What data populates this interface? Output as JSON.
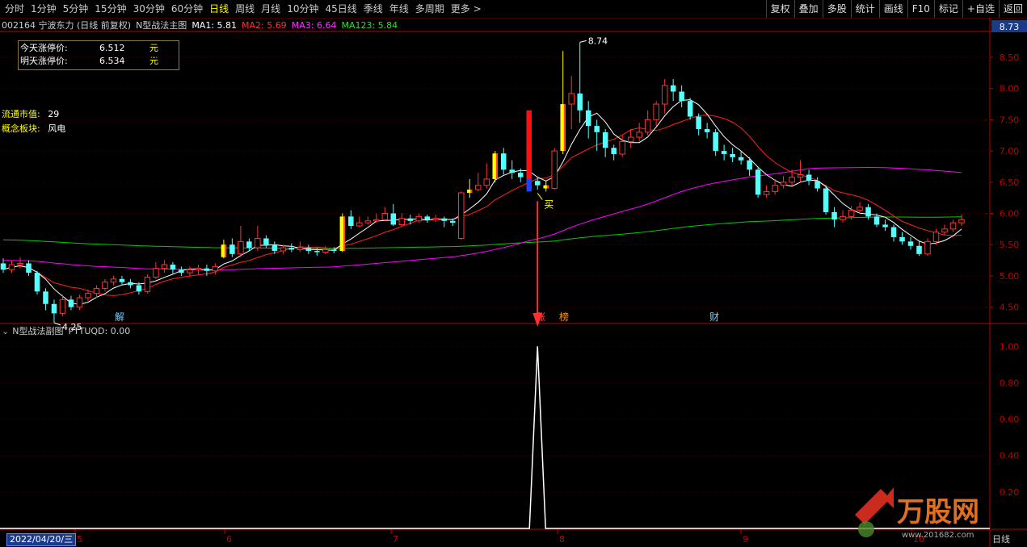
{
  "toolbar": {
    "periods": [
      "分时",
      "1分钟",
      "5分钟",
      "15分钟",
      "30分钟",
      "60分钟",
      "日线",
      "周线",
      "月线",
      "10分钟",
      "45日线",
      "季线",
      "年线",
      "多周期",
      "更多 >"
    ],
    "active": "日线",
    "buttons": [
      "复权",
      "叠加",
      "多股",
      "统计",
      "画线",
      "F10",
      "标记",
      "+自选",
      "返回"
    ]
  },
  "header": {
    "stock": "002164 宁波东力 (日线 前复权)",
    "indicator": "N型战法主图",
    "ma1": "MA1: 5.81",
    "ma2": "MA2: 5.69",
    "ma3": "MA3: 6.64",
    "ma123": "MA123: 5.84",
    "price_tag": "8.73"
  },
  "limit_box": {
    "today_label": "今天涨停价:",
    "today_value": "6.512",
    "tomorrow_label": "明天涨停价:",
    "tomorrow_value": "6.534",
    "unit": "元"
  },
  "side_info": {
    "float_cap_label": "流通市值:",
    "float_cap_value": "29",
    "concept_label": "概念板块:",
    "concept_value": "风电"
  },
  "subchart": {
    "title": "N型战法副图",
    "value": "PTTUQD: 0.00"
  },
  "date_label": "2022/04/20/三",
  "period_label": "日线",
  "logo": {
    "text": "万股网",
    "url": "www.201682.com"
  },
  "colors": {
    "up": "#ff3232",
    "down": "#54ffff",
    "ma1": "#ffffff",
    "ma2": "#ff2020",
    "ma3": "#ff00ff",
    "ma123": "#00cc00",
    "highlight": "#ffff00",
    "buy": "#ffff00",
    "axis": "#c00000"
  },
  "chart_data": [
    {
      "type": "candlestick",
      "title": "N型战法主图",
      "ylim": [
        4.25,
        8.9
      ],
      "yticks": [
        4.5,
        5.0,
        5.5,
        6.0,
        6.5,
        7.0,
        7.5,
        8.0,
        8.5
      ],
      "xticks": [
        "5",
        "6",
        "7",
        "8",
        "9",
        "10"
      ],
      "annotations": [
        {
          "text": "8.74",
          "type": "high"
        },
        {
          "text": "4.25",
          "type": "low"
        },
        {
          "text": "买",
          "type": "buy-signal"
        }
      ],
      "event_labels": [
        "解",
        "涨",
        "榜",
        "财"
      ],
      "candles": [
        [
          5.2,
          5.1,
          5.28,
          5.05
        ],
        [
          5.1,
          5.18,
          5.25,
          5.05
        ],
        [
          5.18,
          5.2,
          5.3,
          5.12
        ],
        [
          5.2,
          5.05,
          5.25,
          5.0
        ],
        [
          5.05,
          4.75,
          5.08,
          4.7
        ],
        [
          4.75,
          4.55,
          4.8,
          4.45
        ],
        [
          4.55,
          4.4,
          4.62,
          4.25
        ],
        [
          4.4,
          4.62,
          4.7,
          4.35
        ],
        [
          4.62,
          4.5,
          4.68,
          4.45
        ],
        [
          4.5,
          4.65,
          4.7,
          4.45
        ],
        [
          4.65,
          4.72,
          4.78,
          4.6
        ],
        [
          4.72,
          4.8,
          4.85,
          4.65
        ],
        [
          4.8,
          4.9,
          4.95,
          4.75
        ],
        [
          4.9,
          4.95,
          5.0,
          4.85
        ],
        [
          4.95,
          4.9,
          5.0,
          4.85
        ],
        [
          4.9,
          4.85,
          4.95,
          4.8
        ],
        [
          4.85,
          4.75,
          4.9,
          4.7
        ],
        [
          4.75,
          4.98,
          5.02,
          4.72
        ],
        [
          4.98,
          5.12,
          5.22,
          4.95
        ],
        [
          5.12,
          5.18,
          5.25,
          5.05
        ],
        [
          5.18,
          5.1,
          5.22,
          5.02
        ],
        [
          5.1,
          5.05,
          5.15,
          5.0
        ],
        [
          5.05,
          5.1,
          5.15,
          5.0
        ],
        [
          5.1,
          5.12,
          5.18,
          5.02
        ],
        [
          5.12,
          5.08,
          5.18,
          5.0
        ],
        [
          5.08,
          5.15,
          5.2,
          5.02
        ],
        [
          5.3,
          5.5,
          5.58,
          5.28
        ],
        [
          5.5,
          5.35,
          5.6,
          5.3
        ],
        [
          5.35,
          5.55,
          5.8,
          5.3
        ],
        [
          5.55,
          5.45,
          5.6,
          5.4
        ],
        [
          5.45,
          5.6,
          5.8,
          5.4
        ],
        [
          5.6,
          5.5,
          5.65,
          5.45
        ],
        [
          5.5,
          5.4,
          5.55,
          5.35
        ],
        [
          5.4,
          5.45,
          5.5,
          5.35
        ],
        [
          5.45,
          5.42,
          5.52,
          5.38
        ],
        [
          5.42,
          5.45,
          5.55,
          5.38
        ],
        [
          5.45,
          5.4,
          5.5,
          5.35
        ],
        [
          5.4,
          5.38,
          5.45,
          5.32
        ],
        [
          5.38,
          5.42,
          5.48,
          5.35
        ],
        [
          5.42,
          5.4,
          5.46,
          5.36
        ],
        [
          5.4,
          5.95,
          6.0,
          5.38
        ],
        [
          5.95,
          5.8,
          6.05,
          5.75
        ],
        [
          5.8,
          5.85,
          5.95,
          5.78
        ],
        [
          5.85,
          5.88,
          5.95,
          5.82
        ],
        [
          5.88,
          5.9,
          6.0,
          5.85
        ],
        [
          5.9,
          6.0,
          6.1,
          5.88
        ],
        [
          6.0,
          5.82,
          6.15,
          5.8
        ],
        [
          5.82,
          5.92,
          6.0,
          5.8
        ],
        [
          5.92,
          5.88,
          5.98,
          5.82
        ],
        [
          5.88,
          5.95,
          6.0,
          5.85
        ],
        [
          5.95,
          5.9,
          5.98,
          5.85
        ],
        [
          5.9,
          5.92,
          5.98,
          5.86
        ],
        [
          5.92,
          5.88,
          5.95,
          5.78
        ],
        [
          5.88,
          5.85,
          5.92,
          5.8
        ],
        [
          5.6,
          6.33,
          6.35,
          5.58
        ],
        [
          6.33,
          6.38,
          6.55,
          6.25
        ],
        [
          6.38,
          6.45,
          6.65,
          6.35
        ],
        [
          6.45,
          6.55,
          6.8,
          6.4
        ],
        [
          6.55,
          6.96,
          7.0,
          6.5
        ],
        [
          6.96,
          6.7,
          7.05,
          6.62
        ],
        [
          6.7,
          6.65,
          6.85,
          6.55
        ],
        [
          6.65,
          6.58,
          6.72,
          6.5
        ],
        [
          6.58,
          6.52,
          6.65,
          6.45
        ],
        [
          6.52,
          6.45,
          6.58,
          6.38
        ],
        [
          6.45,
          6.4,
          6.52,
          6.35
        ],
        [
          6.4,
          7.0,
          7.05,
          6.38
        ],
        [
          7.0,
          7.75,
          8.6,
          6.95
        ],
        [
          7.75,
          7.92,
          8.2,
          7.35
        ],
        [
          7.92,
          7.65,
          8.74,
          7.45
        ],
        [
          7.65,
          7.4,
          7.8,
          7.2
        ],
        [
          7.4,
          7.3,
          7.5,
          7.0
        ],
        [
          7.3,
          7.05,
          7.35,
          6.9
        ],
        [
          7.05,
          6.95,
          7.1,
          6.85
        ],
        [
          6.95,
          7.15,
          7.25,
          6.9
        ],
        [
          7.15,
          7.22,
          7.35,
          7.05
        ],
        [
          7.22,
          7.3,
          7.45,
          7.15
        ],
        [
          7.3,
          7.5,
          7.65,
          7.25
        ],
        [
          7.5,
          7.75,
          7.8,
          7.4
        ],
        [
          7.75,
          8.05,
          8.15,
          7.6
        ],
        [
          8.05,
          7.95,
          8.15,
          7.8
        ],
        [
          7.95,
          7.8,
          8.05,
          7.7
        ],
        [
          7.8,
          7.55,
          7.85,
          7.5
        ],
        [
          7.55,
          7.35,
          7.6,
          7.25
        ],
        [
          7.35,
          7.3,
          7.45,
          7.2
        ],
        [
          7.3,
          7.0,
          7.35,
          6.92
        ],
        [
          7.0,
          6.95,
          7.1,
          6.85
        ],
        [
          6.95,
          6.9,
          7.05,
          6.82
        ],
        [
          6.9,
          6.85,
          7.0,
          6.78
        ],
        [
          6.85,
          6.7,
          6.9,
          6.6
        ],
        [
          6.7,
          6.3,
          6.75,
          6.25
        ],
        [
          6.3,
          6.35,
          6.45,
          6.25
        ],
        [
          6.35,
          6.45,
          6.55,
          6.3
        ],
        [
          6.45,
          6.5,
          6.6,
          6.4
        ],
        [
          6.5,
          6.58,
          6.7,
          6.45
        ],
        [
          6.58,
          6.62,
          6.85,
          6.5
        ],
        [
          6.62,
          6.52,
          6.7,
          6.45
        ],
        [
          6.52,
          6.4,
          6.58,
          6.35
        ],
        [
          6.4,
          6.02,
          6.45,
          5.98
        ],
        [
          6.02,
          5.9,
          6.1,
          5.78
        ],
        [
          5.9,
          5.95,
          6.05,
          5.85
        ],
        [
          5.95,
          6.05,
          6.12,
          5.9
        ],
        [
          6.05,
          6.1,
          6.18,
          6.0
        ],
        [
          6.1,
          5.95,
          6.15,
          5.9
        ],
        [
          5.95,
          5.82,
          6.0,
          5.78
        ],
        [
          5.82,
          5.78,
          5.9,
          5.72
        ],
        [
          5.78,
          5.62,
          5.82,
          5.55
        ],
        [
          5.62,
          5.55,
          5.7,
          5.5
        ],
        [
          5.55,
          5.48,
          5.62,
          5.42
        ],
        [
          5.48,
          5.35,
          5.55,
          5.32
        ],
        [
          5.35,
          5.55,
          5.6,
          5.32
        ],
        [
          5.55,
          5.7,
          5.75,
          5.5
        ],
        [
          5.7,
          5.75,
          5.82,
          5.65
        ],
        [
          5.75,
          5.85,
          5.9,
          5.7
        ],
        [
          5.85,
          5.9,
          5.98,
          5.8
        ]
      ],
      "highlight_yellow": [
        26,
        40,
        55,
        58,
        64,
        66
      ],
      "highlight_red": [
        62
      ],
      "highlight_blue": [
        62
      ],
      "buy_index": 63
    },
    {
      "type": "line",
      "title": "N型战法副图",
      "series": [
        {
          "name": "PTTUQD",
          "spike_index": 63,
          "spike_value": 1.0
        }
      ],
      "ylim": [
        0,
        1.05
      ],
      "yticks": [
        0.2,
        0.4,
        0.6,
        0.8,
        1.0
      ]
    }
  ]
}
